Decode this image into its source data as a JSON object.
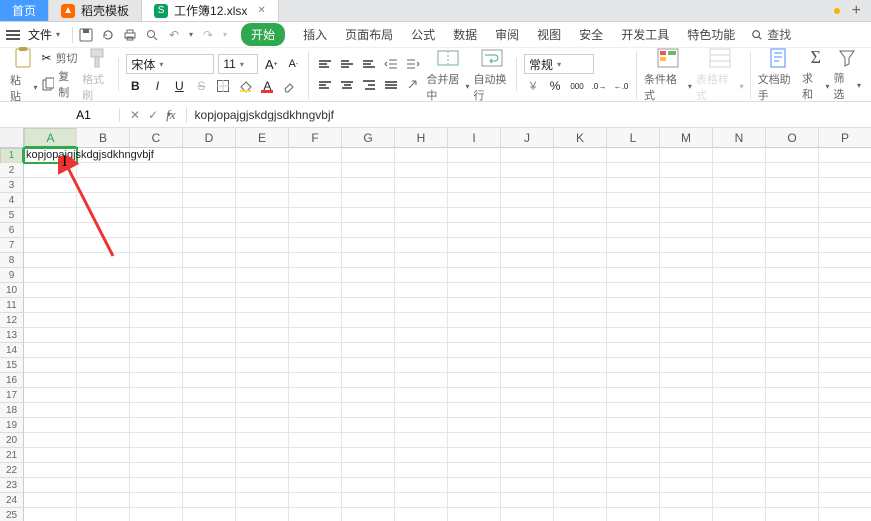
{
  "tabs": {
    "home": "首页",
    "templates": "稻壳模板",
    "workbook": "工作簿12.xlsx"
  },
  "menu": {
    "file": "文件"
  },
  "ribbon": {
    "tabs": {
      "start": "开始",
      "insert": "插入",
      "pagelayout": "页面布局",
      "formula": "公式",
      "data": "数据",
      "review": "审阅",
      "view": "视图",
      "security": "安全",
      "devtools": "开发工具",
      "special": "特色功能"
    },
    "search": "查找"
  },
  "toolbar": {
    "paste": "粘贴",
    "cut": "剪切",
    "copy": "复制",
    "formatpainter": "格式刷",
    "font_name": "宋体",
    "font_size": "11",
    "merge_center": "合并居中",
    "wrap_text": "自动换行",
    "number_format": "常规",
    "cond_format": "条件格式",
    "table_style": "表格样式",
    "doc_assist": "文档助手",
    "sum": "求和",
    "filter": "筛选"
  },
  "formula_bar": {
    "namebox": "A1",
    "fx": "fx",
    "value": "kopjopajgjskdgjsdkhngvbjf"
  },
  "grid": {
    "cols": [
      "A",
      "B",
      "C",
      "D",
      "E",
      "F",
      "G",
      "H",
      "I",
      "J",
      "K",
      "L",
      "M",
      "N",
      "O",
      "P"
    ],
    "rows": [
      "1",
      "2",
      "3",
      "4",
      "5",
      "6",
      "7",
      "8",
      "9",
      "10",
      "11",
      "12",
      "13",
      "14",
      "15",
      "16",
      "17",
      "18",
      "19",
      "20",
      "21",
      "22",
      "23",
      "24",
      "25"
    ],
    "a1_value": "kopjopajgjskdgjsdkhngvbjf"
  }
}
